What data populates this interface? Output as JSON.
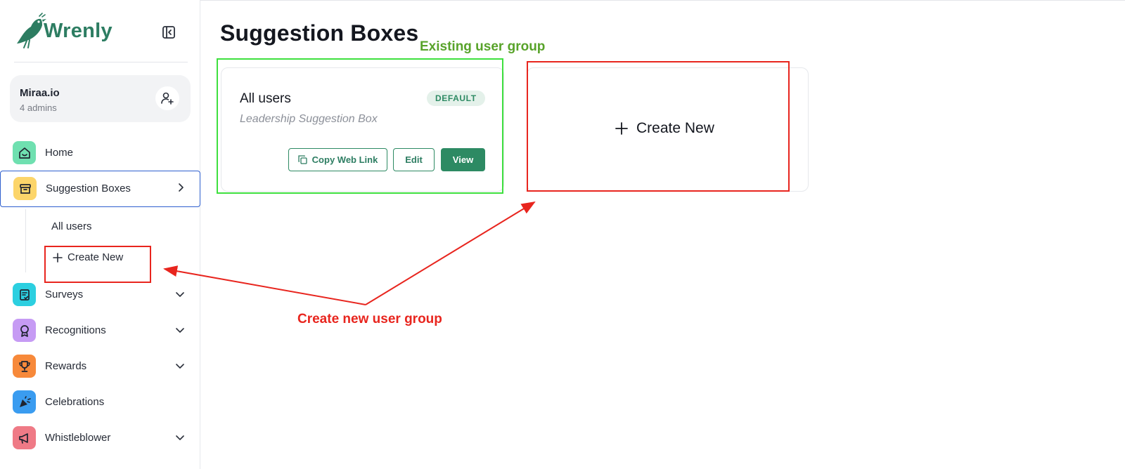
{
  "brand": {
    "name": "Wrenly"
  },
  "org": {
    "name": "Miraa.io",
    "admins": "4 admins"
  },
  "nav": {
    "home": "Home",
    "suggestion_boxes": "Suggestion Boxes",
    "sub_all_users": "All users",
    "sub_create_new": "Create New",
    "surveys": "Surveys",
    "recognitions": "Recognitions",
    "rewards": "Rewards",
    "celebrations": "Celebrations",
    "whistleblower": "Whistleblower"
  },
  "page": {
    "title": "Suggestion Boxes"
  },
  "box": {
    "title": "All users",
    "subtitle": "Leadership Suggestion Box",
    "badge": "DEFAULT",
    "copy_link": "Copy Web Link",
    "edit": "Edit",
    "view": "View"
  },
  "create_card": {
    "label": "Create New"
  },
  "annotations": {
    "existing": "Existing user group",
    "create_new": "Create new user group"
  },
  "colors": {
    "brand": "#2d7d62",
    "annotation_green": "#58a32a",
    "annotation_red": "#e8251e",
    "active_border": "#2e5fce"
  }
}
